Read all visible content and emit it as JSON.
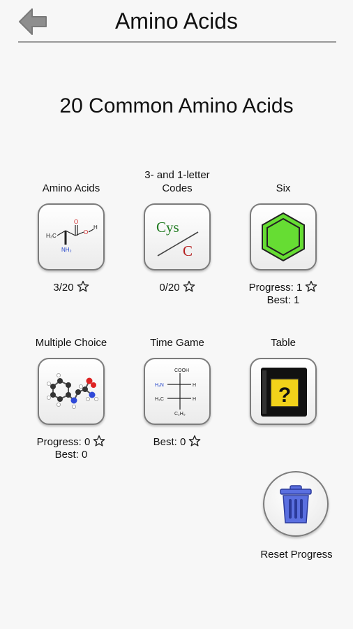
{
  "header": {
    "title": "Amino Acids"
  },
  "heading": "20 Common Amino Acids",
  "tiles": [
    {
      "label": "Amino Acids",
      "stat_line1": "3/20",
      "stat_line2": ""
    },
    {
      "label_line1": "3- and 1-letter",
      "label_line2": "Codes",
      "stat_line1": "0/20",
      "stat_line2": ""
    },
    {
      "label": "Six",
      "stat_line1": "Progress: 1",
      "stat_line2": "Best: 1"
    },
    {
      "label": "Multiple Choice",
      "stat_line1": "Progress: 0",
      "stat_line2": "Best: 0"
    },
    {
      "label": "Time Game",
      "stat_line1": "Best: 0",
      "stat_line2": ""
    },
    {
      "label": "Table",
      "stat_line1": "",
      "stat_line2": ""
    }
  ],
  "cys_icon": {
    "top": "Cys",
    "bottom": "C"
  },
  "time_icon": {
    "cooh": "COOH",
    "h2n": "H₂N",
    "h3c": "H₃C",
    "h1": "H",
    "h2": "H",
    "c2h5": "C₂H₅"
  },
  "alanine_icon": {
    "h3c": "H₃C",
    "nh2": "NH₂",
    "o": "O",
    "h": "H"
  },
  "reset": {
    "label": "Reset Progress"
  },
  "colors": {
    "hexagon": "#66dd33",
    "book": "#111111",
    "question_bg": "#f2d21a",
    "trash": "#5a6fe0",
    "cys_green": "#1f7a1f",
    "c_red": "#b52020"
  }
}
